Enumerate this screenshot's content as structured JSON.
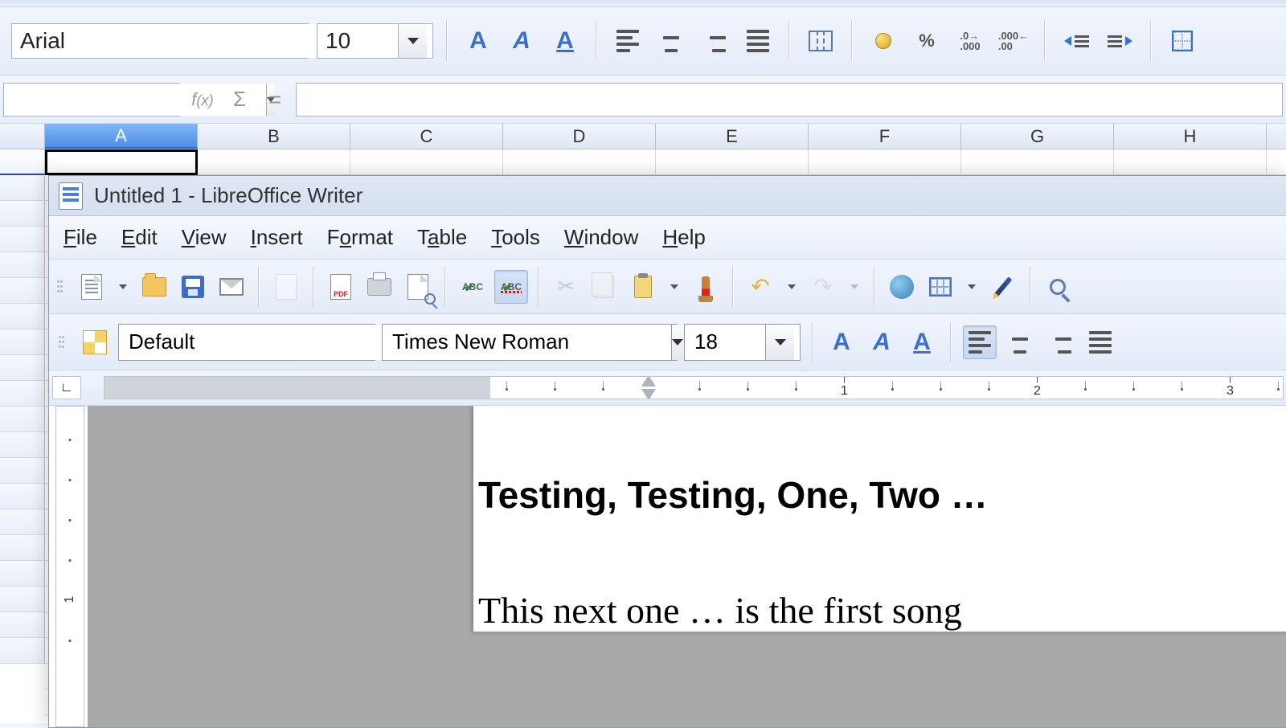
{
  "calc": {
    "font_name": "Arial",
    "font_size": "10",
    "name_box": "",
    "formula": "",
    "columns": [
      "A",
      "B",
      "C",
      "D",
      "E",
      "F",
      "G",
      "H"
    ],
    "selected_col_index": 0,
    "tooltip_percent": "%",
    "tooltip_num1": ".000",
    "tooltip_num2": ".00",
    "tooltip_num_top": ".0",
    "tooltip_num_top2": ".000"
  },
  "writer": {
    "title": "Untitled 1 - LibreOffice Writer",
    "menus": [
      "File",
      "Edit",
      "View",
      "Insert",
      "Format",
      "Table",
      "Tools",
      "Window",
      "Help"
    ],
    "style": "Default",
    "font_name": "Times New Roman",
    "font_size": "18",
    "ruler_numbers": [
      "1",
      "2",
      "3"
    ],
    "v_ruler_numbers": [
      "1"
    ],
    "abc_label": "ABC",
    "doc": {
      "heading": "Testing, Testing, One, Two …",
      "body_line1": "This next one … is the first song"
    }
  }
}
